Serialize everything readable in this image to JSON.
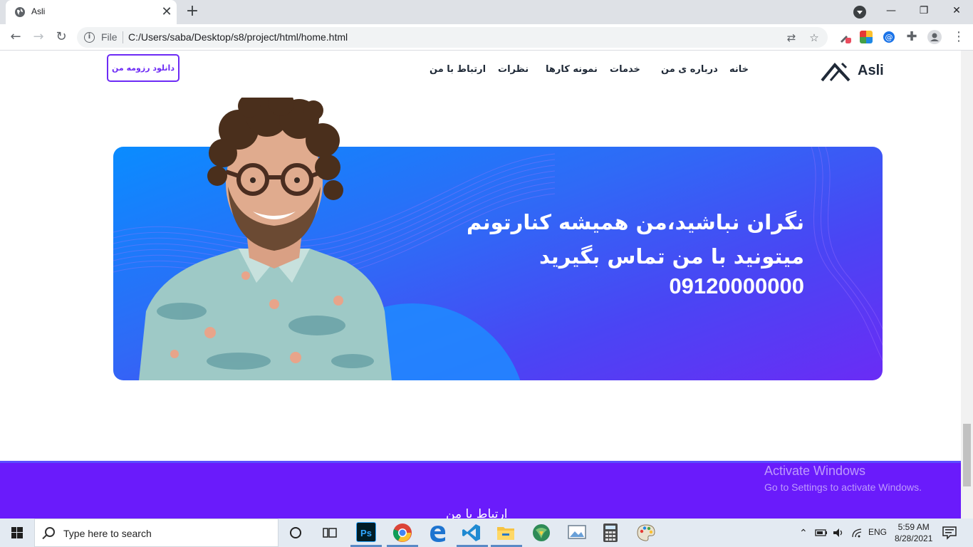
{
  "browser": {
    "tab_title": "Asli",
    "tab_close": "✕",
    "new_tab": "+",
    "file_label": "File",
    "url": "C:/Users/saba/Desktop/s8/project/html/home.html",
    "window_controls": {
      "minimize": "—",
      "restore": "❐",
      "close": "✕"
    }
  },
  "site": {
    "logo_text": "Asli",
    "nav": [
      {
        "label": "خانه"
      },
      {
        "label": "درباره ی من"
      },
      {
        "label": "خدمات"
      },
      {
        "label": "نمونه کارها"
      },
      {
        "label": "نظرات"
      },
      {
        "label": "ارتباط با من"
      }
    ],
    "cv_button": "دانلود رزومه من"
  },
  "banner": {
    "line1": "نگران نباشید،من همیشه کنارتونم",
    "line2": "میتونید با من تماس بگیرید",
    "phone": "09120000000"
  },
  "footer": {
    "title": "ارتباط با من"
  },
  "watermark": {
    "line1": "Activate Windows",
    "line2": "Go to Settings to activate Windows."
  },
  "taskbar": {
    "search_placeholder": "Type here to search",
    "photoshop_label": "Ps",
    "language": "ENG",
    "time": "5:59 AM",
    "date": "8/28/2021"
  }
}
